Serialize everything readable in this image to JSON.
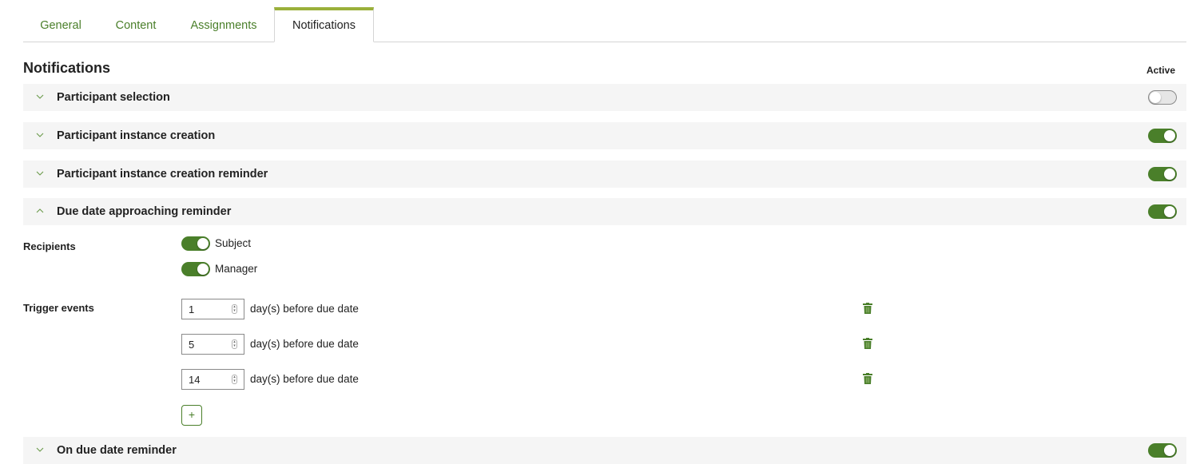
{
  "tabs": [
    {
      "label": "General",
      "active": false
    },
    {
      "label": "Content",
      "active": false
    },
    {
      "label": "Assignments",
      "active": false
    },
    {
      "label": "Notifications",
      "active": true
    }
  ],
  "section": {
    "title": "Notifications",
    "active_column_label": "Active"
  },
  "notifications": [
    {
      "label": "Participant selection",
      "expanded": false,
      "active": false
    },
    {
      "label": "Participant instance creation",
      "expanded": false,
      "active": true
    },
    {
      "label": "Participant instance creation reminder",
      "expanded": false,
      "active": true
    },
    {
      "label": "Due date approaching reminder",
      "expanded": true,
      "active": true
    },
    {
      "label": "On due date reminder",
      "expanded": false,
      "active": true
    }
  ],
  "expanded_panel": {
    "recipients_label": "Recipients",
    "recipients": [
      {
        "label": "Subject",
        "enabled": true
      },
      {
        "label": "Manager",
        "enabled": true
      }
    ],
    "trigger_events_label": "Trigger events",
    "trigger_events": [
      {
        "value": "1",
        "suffix": "day(s) before due date"
      },
      {
        "value": "5",
        "suffix": "day(s) before due date"
      },
      {
        "value": "14",
        "suffix": "day(s) before due date"
      }
    ],
    "add_button_label": "+"
  },
  "colors": {
    "accent_green": "#4a7f2a",
    "tab_indicator": "#9ab03a",
    "row_background": "#f5f5f5"
  }
}
